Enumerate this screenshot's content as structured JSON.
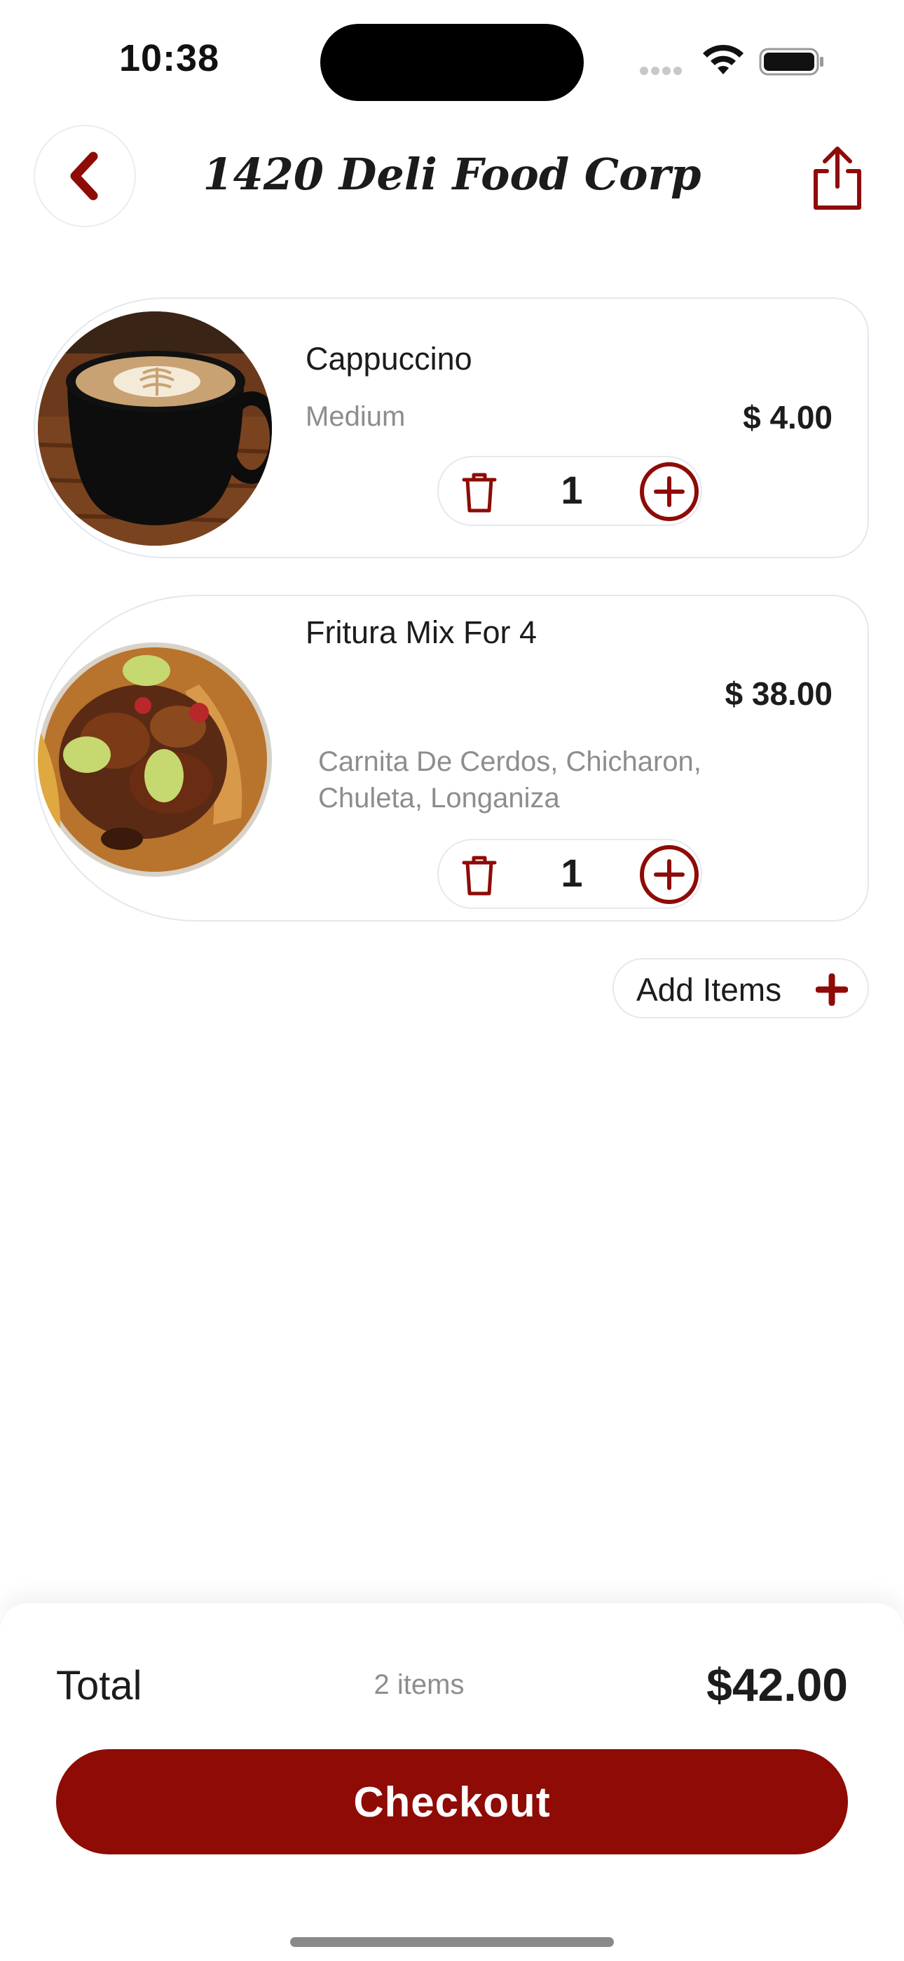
{
  "status_bar": {
    "time": "10:38"
  },
  "header": {
    "title": "1420 Deli Food Corp",
    "back_icon": "chevron-left-icon",
    "share_icon": "share-icon"
  },
  "cart": {
    "items": [
      {
        "name": "Cappuccino",
        "size": "Medium",
        "price": "$ 4.00",
        "quantity": "1",
        "image": "coffee-cup-photo"
      },
      {
        "name": "Fritura Mix For 4",
        "price": "$ 38.00",
        "options": "Carnita De Cerdos,  Chicharon, Chuleta,  Longaniza",
        "quantity": "1",
        "image": "fritura-platter-photo"
      }
    ],
    "add_items_label": "Add Items"
  },
  "summary": {
    "total_label": "Total",
    "item_count": "2 items",
    "total_amount": "$42.00",
    "checkout_label": "Checkout"
  },
  "colors": {
    "accent": "#8e0b06",
    "card_border": "#e2e8f0",
    "muted_text": "#8d8d8d"
  }
}
